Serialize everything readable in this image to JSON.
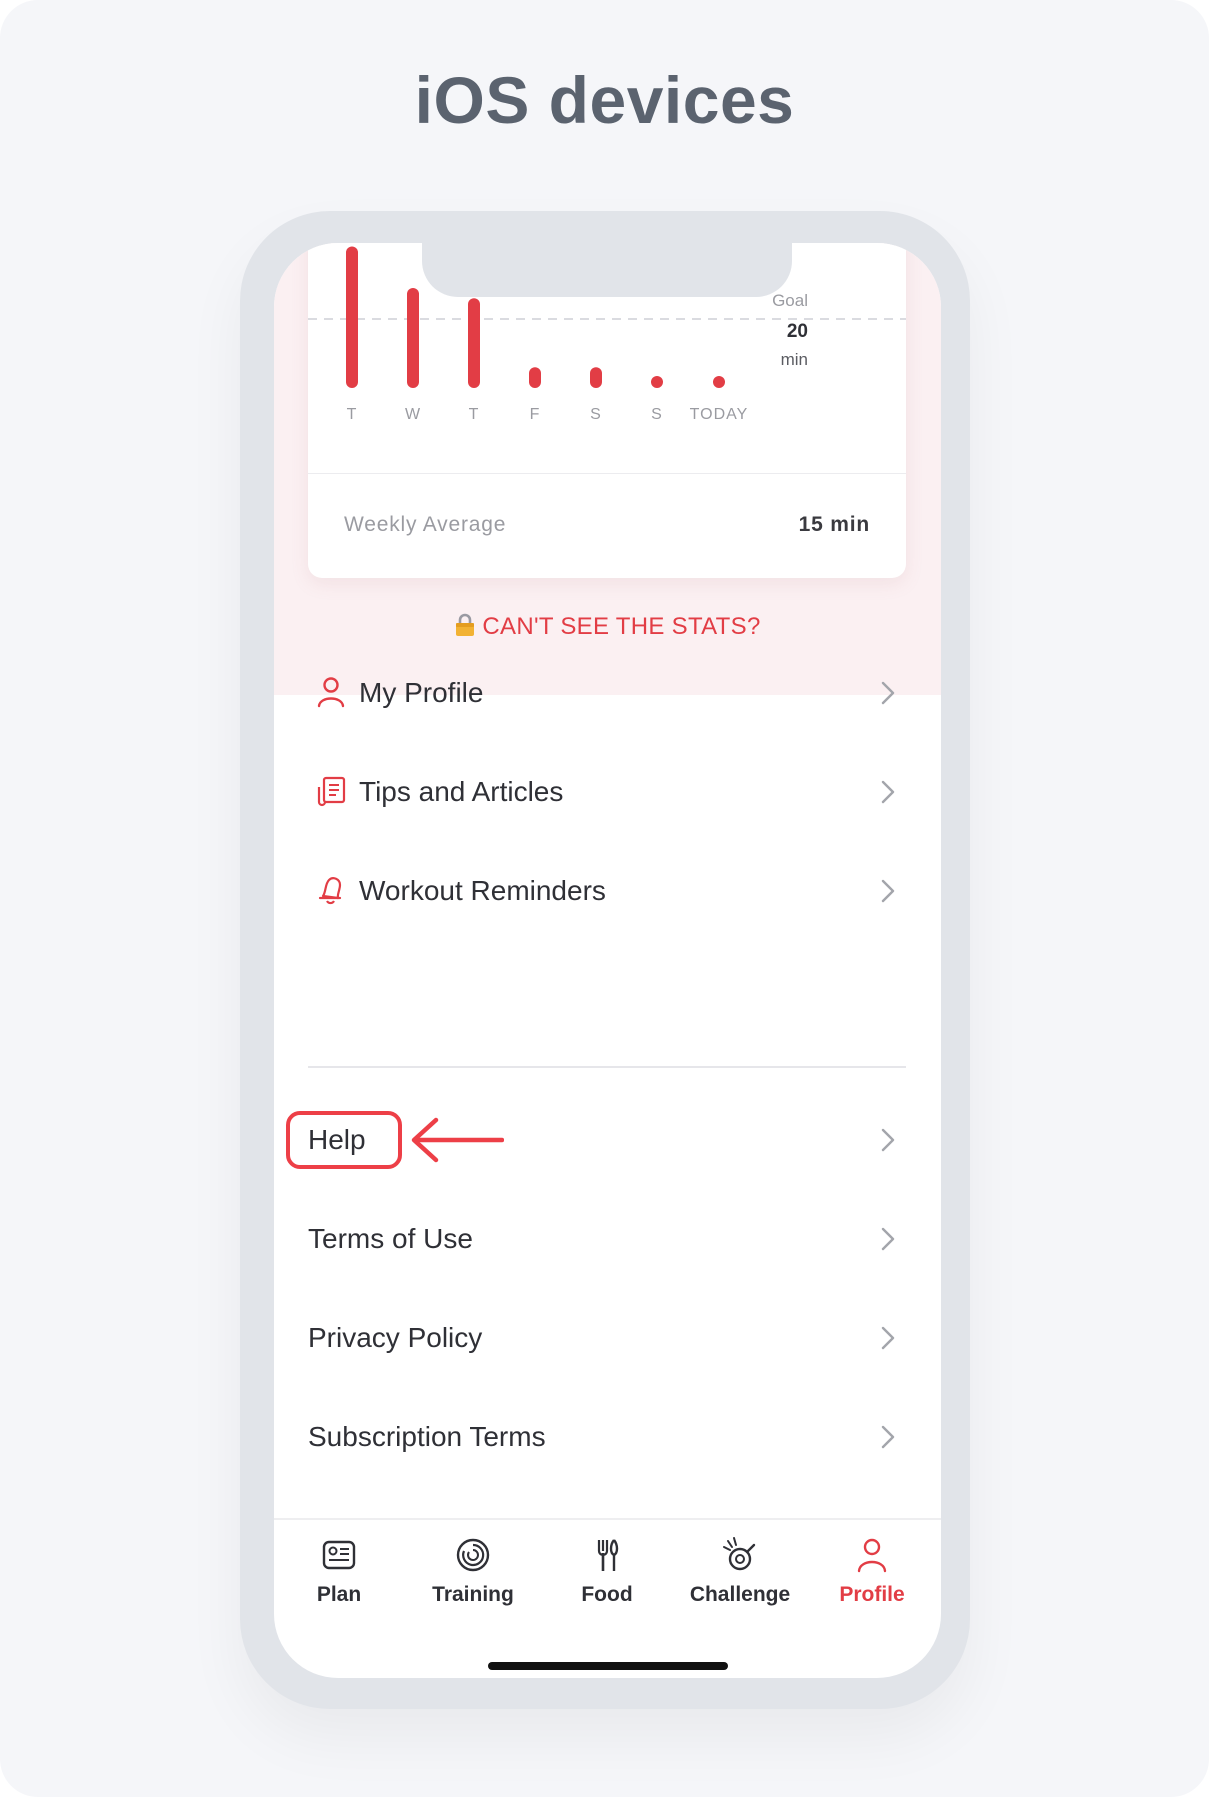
{
  "page": {
    "title": "iOS devices"
  },
  "chart": {
    "goal_label": "Goal",
    "goal_value": "20",
    "goal_unit": "min",
    "days": [
      "T",
      "W",
      "T",
      "F",
      "S",
      "S",
      "TODAY"
    ],
    "minutes_relative_to_goal": [
      2.05,
      1.45,
      1.3,
      0.3,
      0.3,
      0.15,
      0.15
    ],
    "bar_color": "#e23d45",
    "weekly_average_label": "Weekly Average",
    "weekly_average_value": "15 min"
  },
  "stats_link": {
    "label": "CAN'T SEE THE STATS?",
    "icon": "lock-icon"
  },
  "menu": {
    "primary": [
      {
        "label": "My Profile",
        "icon": "person-icon"
      },
      {
        "label": "Tips and Articles",
        "icon": "article-icon"
      },
      {
        "label": "Workout Reminders",
        "icon": "bell-icon"
      }
    ],
    "secondary": [
      {
        "label": "Help"
      },
      {
        "label": "Terms of Use"
      },
      {
        "label": "Privacy Policy"
      },
      {
        "label": "Subscription Terms"
      }
    ]
  },
  "tabs": [
    {
      "label": "Plan",
      "icon": "plan-icon",
      "active": false
    },
    {
      "label": "Training",
      "icon": "training-icon",
      "active": false
    },
    {
      "label": "Food",
      "icon": "food-icon",
      "active": false
    },
    {
      "label": "Challenge",
      "icon": "challenge-icon",
      "active": false
    },
    {
      "label": "Profile",
      "icon": "profile-icon",
      "active": true
    }
  ],
  "colors": {
    "accent": "#e23d45",
    "highlight": "#ed3f47"
  }
}
